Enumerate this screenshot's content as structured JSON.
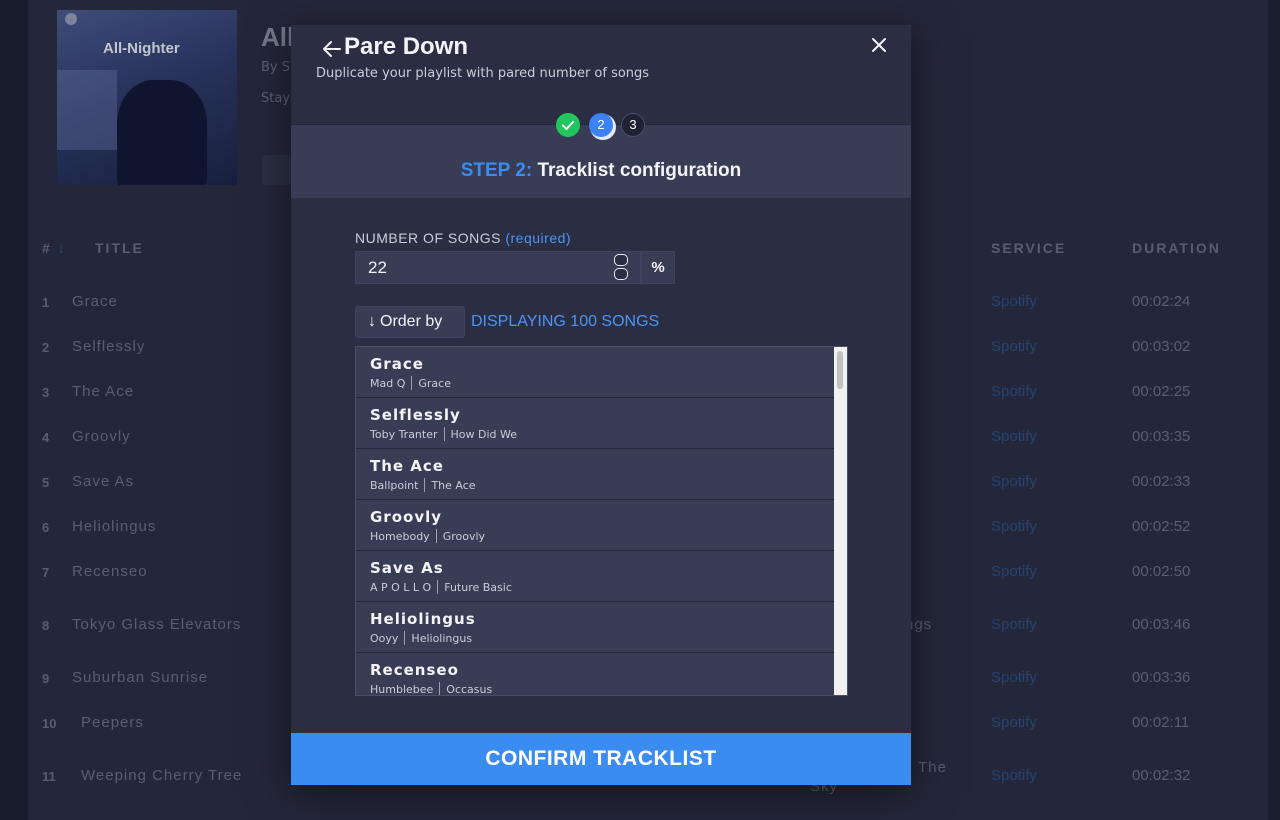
{
  "background": {
    "cover_title": "All-Nighter",
    "playlist_title": "All",
    "playlist_by": "By S",
    "playlist_desc": "Stay",
    "headers": {
      "num": "#",
      "title": "TITLE",
      "service": "SERVICE",
      "duration": "DURATION"
    },
    "rows": [
      {
        "num": "1",
        "title": "Grace",
        "service": "Spotify",
        "duration": "00:02:24"
      },
      {
        "num": "2",
        "title": "Selflessly",
        "service": "Spotify",
        "duration": "00:03:02"
      },
      {
        "num": "3",
        "title": "The Ace",
        "service": "Spotify",
        "duration": "00:02:25"
      },
      {
        "num": "4",
        "title": "Groovly",
        "service": "Spotify",
        "duration": "00:03:35"
      },
      {
        "num": "5",
        "title": "Save As",
        "service": "Spotify",
        "duration": "00:02:33"
      },
      {
        "num": "6",
        "title": "Heliolingus",
        "service": "Spotify",
        "duration": "00:02:52"
      },
      {
        "num": "7",
        "title": "Recenseo",
        "service": "Spotify",
        "duration": "00:02:50"
      },
      {
        "num": "8",
        "title": "Tokyo Glass Elevators",
        "service": "Spotify",
        "duration": "00:03:46"
      },
      {
        "num": "9",
        "title": "Suburban Sunrise",
        "service": "Spotify",
        "duration": "00:03:36"
      },
      {
        "num": "10",
        "title": "Peepers",
        "service": "Spotify",
        "duration": "00:02:11"
      },
      {
        "num": "11",
        "title": "Weeping Cherry Tree",
        "service": "Spotify",
        "duration": "00:02:32"
      }
    ],
    "ghost_ngs": "ngs",
    "ghost_the": "The",
    "ghost_sky": "Sky"
  },
  "modal": {
    "title": "Pare Down",
    "subtitle": "Duplicate your playlist with pared number of songs",
    "steps": {
      "current": "2",
      "next": "3"
    },
    "step_prefix": "STEP 2:",
    "step_title": "Tracklist configuration",
    "number_label": "NUMBER OF SONGS",
    "required_label": "(required)",
    "number_value": "22",
    "percent_label": "%",
    "order_label": "Order by",
    "displaying_label": "DISPLAYING 100 SONGS",
    "tracks": [
      {
        "title": "Grace",
        "artist": "Mad Q",
        "album": "Grace"
      },
      {
        "title": "Selflessly",
        "artist": "Toby Tranter",
        "album": "How Did We"
      },
      {
        "title": "The Ace",
        "artist": "Ballpoint",
        "album": "The Ace"
      },
      {
        "title": "Groovly",
        "artist": "Homebody",
        "album": "Groovly"
      },
      {
        "title": "Save As",
        "artist": "A P O L L O",
        "album": "Future Basic"
      },
      {
        "title": "Heliolingus",
        "artist": "Ooyy",
        "album": "Heliolingus"
      },
      {
        "title": "Recenseo",
        "artist": "Humblebee",
        "album": "Occasus"
      }
    ],
    "confirm_label": "CONFIRM TRACKLIST"
  }
}
